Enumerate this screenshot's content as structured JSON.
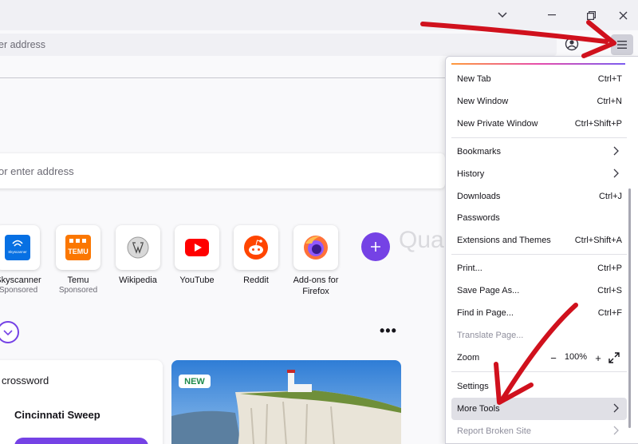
{
  "toolbar": {
    "url_placeholder": "er address",
    "menu_button_label": "Open application menu"
  },
  "page": {
    "search_placeholder": "or enter address",
    "shortcuts": [
      {
        "label": "Skyscanner",
        "sublabel": "Sponsored",
        "icon": "skyscanner-icon"
      },
      {
        "label": "Temu",
        "sublabel": "Sponsored",
        "icon": "temu-icon"
      },
      {
        "label": "Wikipedia",
        "sublabel": "",
        "icon": "wikipedia-icon"
      },
      {
        "label": "YouTube",
        "sublabel": "",
        "icon": "youtube-icon"
      },
      {
        "label": "Reddit",
        "sublabel": "",
        "icon": "reddit-icon"
      },
      {
        "label": "Add-ons for Firefox",
        "sublabel": "",
        "icon": "firefox-icon"
      }
    ],
    "add_shortcut_icon": "plus-icon",
    "more_options": "•••",
    "card1": {
      "title": "crossword",
      "heading": "Cincinnati Sweep"
    },
    "card2": {
      "badge": "NEW"
    },
    "temu_logo_text": "TEMU",
    "skyscanner_logo_text": "Skyscanner"
  },
  "menu": {
    "items": [
      {
        "label": "New Tab",
        "shortcut": "Ctrl+T"
      },
      {
        "label": "New Window",
        "shortcut": "Ctrl+N"
      },
      {
        "label": "New Private Window",
        "shortcut": "Ctrl+Shift+P"
      },
      {
        "label": "Bookmarks",
        "shortcut": ""
      },
      {
        "label": "History",
        "shortcut": ""
      },
      {
        "label": "Downloads",
        "shortcut": "Ctrl+J"
      },
      {
        "label": "Passwords",
        "shortcut": ""
      },
      {
        "label": "Extensions and Themes",
        "shortcut": "Ctrl+Shift+A"
      },
      {
        "label": "Print...",
        "shortcut": "Ctrl+P"
      },
      {
        "label": "Save Page As...",
        "shortcut": "Ctrl+S"
      },
      {
        "label": "Find in Page...",
        "shortcut": "Ctrl+F"
      },
      {
        "label": "Translate Page...",
        "shortcut": ""
      },
      {
        "label": "Zoom",
        "shortcut": ""
      },
      {
        "label": "Settings",
        "shortcut": ""
      },
      {
        "label": "More Tools",
        "shortcut": ""
      },
      {
        "label": "Report Broken Site",
        "shortcut": ""
      }
    ],
    "zoom": {
      "minus": "−",
      "value": "100%",
      "plus": "+"
    }
  },
  "watermark": "Quantrimang",
  "colors": {
    "accent": "#7542e5",
    "annotation_arrow": "#d0111d",
    "menu_hover": "#e0e0e6"
  }
}
